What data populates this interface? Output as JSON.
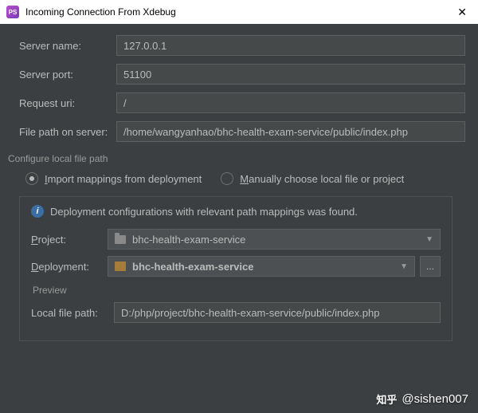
{
  "window": {
    "title": "Incoming Connection From Xdebug",
    "app_icon_text": "PS"
  },
  "fields": {
    "server_name": {
      "label": "Server name:",
      "value": "127.0.0.1"
    },
    "server_port": {
      "label": "Server port:",
      "value": "51100"
    },
    "request_uri": {
      "label": "Request uri:",
      "value": "/"
    },
    "file_path_on_server": {
      "label": "File path on server:",
      "value": "/home/wangyanhao/bhc-health-exam-service/public/index.php"
    }
  },
  "configure_section_label": "Configure local file path",
  "radios": {
    "import": {
      "label_pre": "I",
      "label_post": "mport mappings from deployment",
      "selected": true
    },
    "manual": {
      "label_pre": "M",
      "label_post": "anually choose local file or project",
      "selected": false
    }
  },
  "info_text": "Deployment configurations with relevant path mappings was found.",
  "project": {
    "label_pre": "P",
    "label_post": "roject:",
    "value": "bhc-health-exam-service"
  },
  "deployment": {
    "label_pre": "D",
    "label_post": "eployment:",
    "value": "bhc-health-exam-service",
    "ellipsis": "..."
  },
  "preview_label": "Preview",
  "local_file_path": {
    "label": "Local file path:",
    "value": "D:/php/project/bhc-health-exam-service/public/index.php"
  },
  "watermark": {
    "logo": "知乎",
    "text": "@sishen007"
  }
}
